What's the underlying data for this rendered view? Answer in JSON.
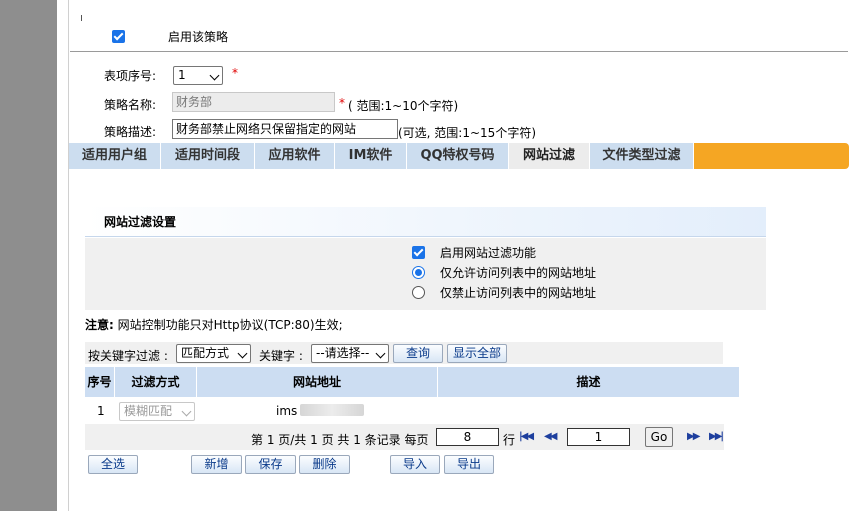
{
  "policy": {
    "enable_label": "启用该策略",
    "seq_label": "表项序号:",
    "seq_value": "1",
    "name_label": "策略名称:",
    "name_value": "财务部",
    "name_hint": "( 范围:1~10个字符)",
    "desc_label": "策略描述:",
    "desc_value": "财务部禁止网络只保留指定的网站",
    "desc_hint": "(可选, 范围:1~15个字符)",
    "required_mark": "*"
  },
  "tabs": [
    {
      "label": "适用用户组"
    },
    {
      "label": "适用时间段"
    },
    {
      "label": "应用软件"
    },
    {
      "label": "IM软件"
    },
    {
      "label": "QQ特权号码"
    },
    {
      "label": "网站过滤"
    },
    {
      "label": "文件类型过滤"
    }
  ],
  "filter": {
    "title": "网站过滤设置",
    "enable_label": "启用网站过滤功能",
    "allow_label": "仅允许访问列表中的网站地址",
    "deny_label": "仅禁止访问列表中的网站地址",
    "note_strong": "注意:",
    "note_text": " 网站控制功能只对Http协议(TCP:80)生效;"
  },
  "search": {
    "keyword_filter_label": "按关键字过滤 :",
    "match_select": "匹配方式",
    "keyword_label": "关键字 :",
    "keyword_select": "--请选择--",
    "query_button": "查询",
    "show_all_button": "显示全部"
  },
  "table": {
    "headers": [
      "序号",
      "过滤方式",
      "网站地址",
      "描述"
    ],
    "rows": [
      {
        "seq": "1",
        "mode": "模糊匹配",
        "url": "ims",
        "desc": ""
      }
    ]
  },
  "pager": {
    "summary": "第 1 页/共 1 页 共 1 条记录 每页",
    "per_page": "8",
    "unit": "行",
    "page": "1",
    "go": "Go"
  },
  "actions": {
    "select_all": "全选",
    "add": "新增",
    "save": "保存",
    "delete": "删除",
    "import": "导入",
    "export": "导出"
  },
  "colors": {
    "tab_bar": "#f5a623",
    "tab_inactive": "#ccddef",
    "table_header": "#ccddf2",
    "accent": "#1a73e8",
    "required": "#e00000"
  }
}
